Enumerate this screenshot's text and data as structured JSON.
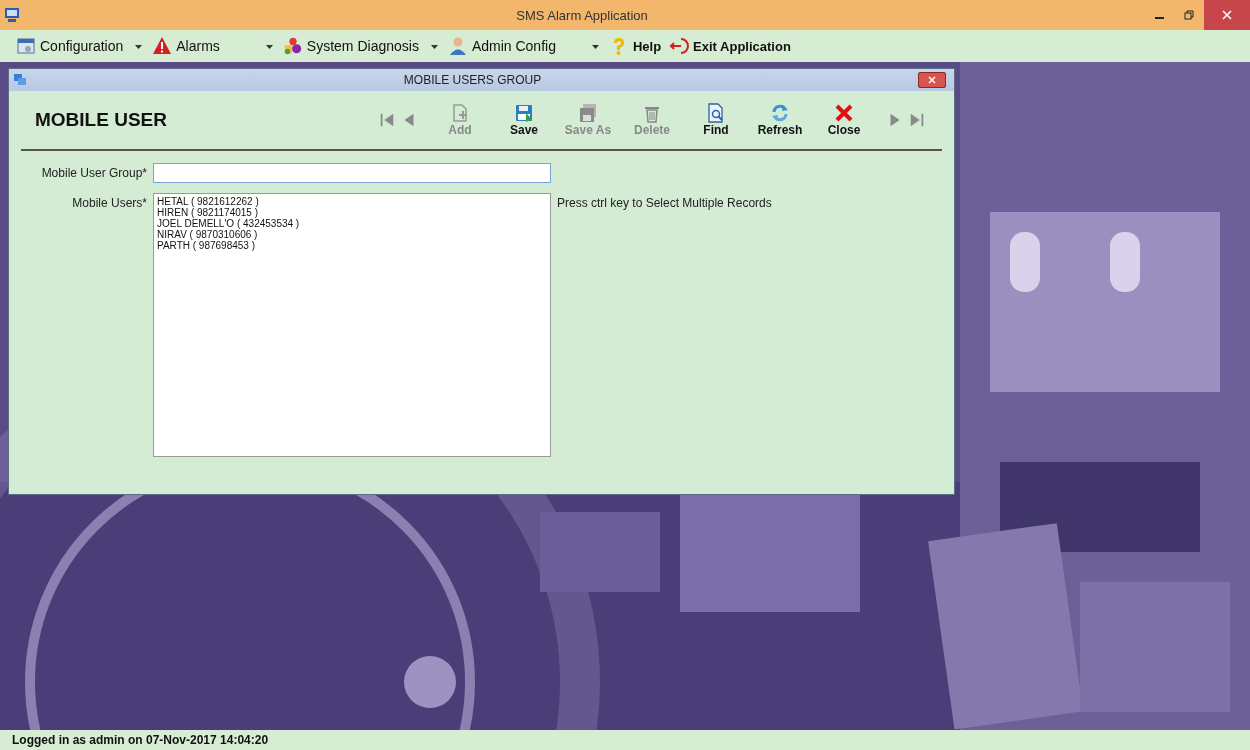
{
  "window": {
    "title": "SMS Alarm Application"
  },
  "menu": [
    {
      "label": "Configuration",
      "kind": "config",
      "dropdown": true
    },
    {
      "label": "Alarms",
      "kind": "alarm",
      "dropdown": true
    },
    {
      "label": "System Diagnosis",
      "kind": "diag",
      "dropdown": true
    },
    {
      "label": "Admin Config",
      "kind": "admin",
      "dropdown": true
    },
    {
      "label": "Help",
      "kind": "help",
      "dropdown": false
    },
    {
      "label": "Exit Application",
      "kind": "exit",
      "dropdown": false
    }
  ],
  "child_window": {
    "title": "MOBILE USERS GROUP",
    "heading": "MOBILE USER",
    "toolbar": [
      {
        "label": "Add",
        "kind": "add",
        "disabled": true
      },
      {
        "label": "Save",
        "kind": "save",
        "disabled": false
      },
      {
        "label": "Save As",
        "kind": "saveas",
        "disabled": true
      },
      {
        "label": "Delete",
        "kind": "delete",
        "disabled": true
      },
      {
        "label": "Find",
        "kind": "find",
        "disabled": false
      },
      {
        "label": "Refresh",
        "kind": "refresh",
        "disabled": false
      },
      {
        "label": "Close",
        "kind": "close",
        "disabled": false
      }
    ],
    "form": {
      "group_label": "Mobile User Group*",
      "users_label": "Mobile Users*",
      "users": [
        {
          "label": "HETAL ( 9821612262 )",
          "selected": false
        },
        {
          "label": "HIREN ( 9821174015 )",
          "selected": false
        },
        {
          "label": "JOEL DEMELL'O ( 432453534 )",
          "selected": false
        },
        {
          "label": "NIRAV ( 9870310606 )",
          "selected": false
        },
        {
          "label": "PARTH ( 987698453 )",
          "selected": false
        }
      ],
      "hint": "Press ctrl key to Select Multiple Records"
    }
  },
  "status_bar": "Logged in as admin on 07-Nov-2017 14:04:20"
}
